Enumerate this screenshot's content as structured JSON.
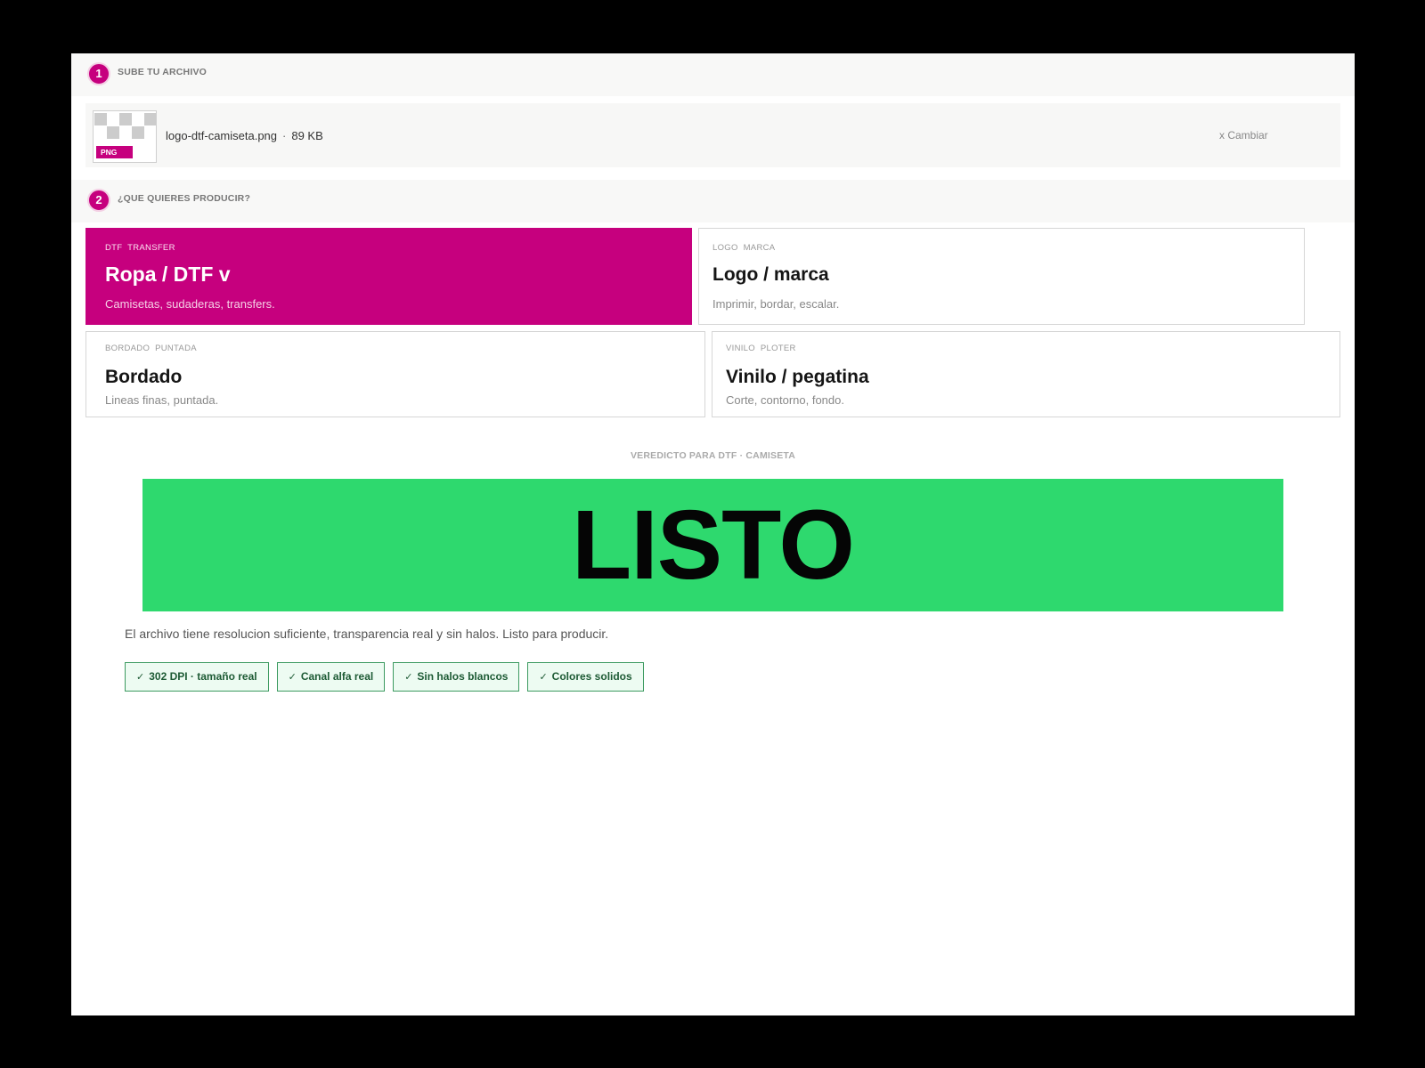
{
  "step1": {
    "number": "1",
    "label": "SUBE TU ARCHIVO"
  },
  "file": {
    "badge": "PNG",
    "name": "logo-dtf-camiseta.png",
    "separator": "·",
    "size": "89 KB",
    "change_label": "x Cambiar"
  },
  "step2": {
    "number": "2",
    "label": "¿QUE QUIERES PRODUCIR?"
  },
  "options": [
    {
      "tag": "DTF TRANSFER",
      "title": "Ropa / DTF  v",
      "desc": "Camisetas, sudaderas, transfers.",
      "selected": true
    },
    {
      "tag": "LOGO MARCA",
      "title": "Logo / marca",
      "desc": "Imprimir, bordar, escalar.",
      "selected": false
    },
    {
      "tag": "BORDADO PUNTADA",
      "title": "Bordado",
      "desc": "Lineas finas, puntada.",
      "selected": false
    },
    {
      "tag": "VINILO PLOTER",
      "title": "Vinilo / pegatina",
      "desc": "Corte, contorno, fondo.",
      "selected": false
    }
  ],
  "verdict": {
    "label": "VEREDICTO PARA DTF · CAMISETA",
    "status": "LISTO",
    "status_color": "#2ed96e",
    "message": "El archivo tiene resolucion suficiente, transparencia real y sin halos. Listo para producir.",
    "checks": [
      {
        "icon": "check-icon",
        "label": "302 DPI · tamaño real"
      },
      {
        "icon": "check-icon",
        "label": "Canal alfa real"
      },
      {
        "icon": "check-icon",
        "label": "Sin halos blancos"
      },
      {
        "icon": "check-icon",
        "label": "Colores solidos"
      }
    ]
  },
  "colors": {
    "accent": "#c6007e",
    "success": "#2ed96e"
  }
}
